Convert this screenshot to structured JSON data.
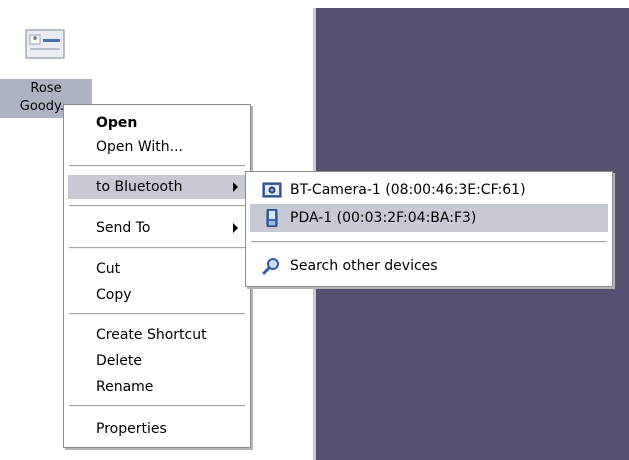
{
  "desktop": {
    "file_icon": "contact-card-icon",
    "file_label_line1": "Rose",
    "file_label_line2": "Goody..."
  },
  "context_menu": {
    "items": [
      {
        "label": "Open",
        "bold": true
      },
      {
        "label": "Open With..."
      },
      {
        "label": "to Bluetooth",
        "has_submenu": true,
        "highlighted": true
      },
      {
        "label": "Send To",
        "has_submenu": true
      },
      {
        "label": "Cut"
      },
      {
        "label": "Copy"
      },
      {
        "label": "Create Shortcut"
      },
      {
        "label": "Delete"
      },
      {
        "label": "Rename"
      },
      {
        "label": "Properties"
      }
    ]
  },
  "bluetooth_submenu": {
    "items": [
      {
        "label": "BT-Camera-1 (08:00:46:3E:CF:61)",
        "icon": "camera-icon"
      },
      {
        "label": "PDA-1 (00:03:2F:04:BA:F3)",
        "icon": "pda-icon",
        "highlighted": true
      },
      {
        "label": "Search other devices",
        "icon": "search-icon"
      }
    ]
  },
  "colors": {
    "highlight": "#c7cad5",
    "dark_panel": "#575170",
    "icon_label_bg": "#aeb3c3"
  }
}
